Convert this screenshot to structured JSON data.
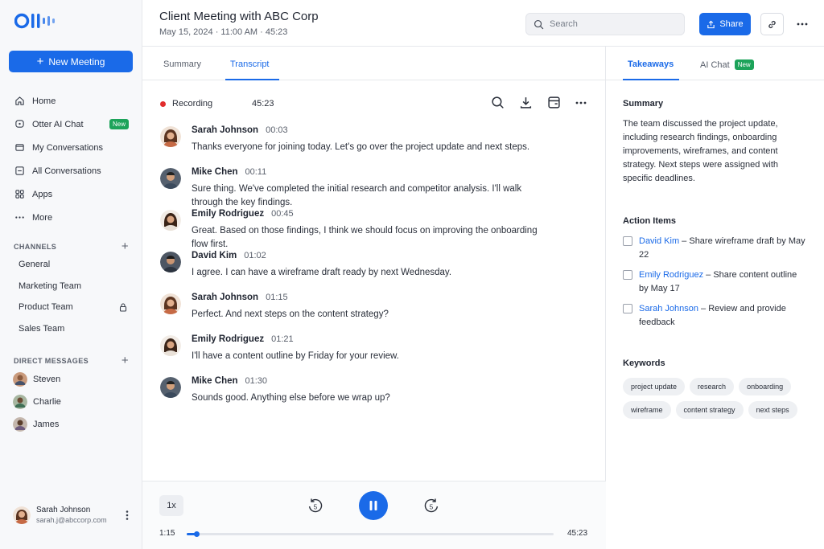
{
  "app": {
    "new_meeting_label": "New Meeting",
    "nav": [
      {
        "label": "Home",
        "icon": "home-icon"
      },
      {
        "label": "Otter AI Chat",
        "icon": "chat-icon",
        "badge": "New"
      },
      {
        "label": "My Conversations",
        "icon": "folder-icon"
      },
      {
        "label": "All Conversations",
        "icon": "list-icon"
      },
      {
        "label": "Apps",
        "icon": "grid-icon"
      },
      {
        "label": "More",
        "icon": "dots-icon"
      }
    ],
    "channels_heading": "CHANNELS",
    "channels": [
      "General",
      "Marketing Team",
      "Product Team",
      "Sales Team"
    ],
    "dm_heading": "DIRECT MESSAGES",
    "direct_messages": [
      "Steven",
      "Charlie",
      "James"
    ],
    "profile": {
      "name": "Sarah Johnson",
      "email": "sarah.j@abccorp.com"
    }
  },
  "header": {
    "title": "Client Meeting with ABC Corp",
    "subtitle": "May 15, 2024 · 11:00 AM · 45:23",
    "search_placeholder": "Search",
    "share_label": "Share"
  },
  "center": {
    "tabs": [
      "Summary",
      "Transcript"
    ],
    "active_tab": "Transcript",
    "recording_label": "Recording",
    "recording_time": "45:23",
    "transcript": [
      {
        "speaker": "Sarah Johnson",
        "time": "00:03",
        "text": "Thanks everyone for joining today. Let's go over the project update and next steps."
      },
      {
        "speaker": "Mike Chen",
        "time": "00:11",
        "text": "Sure thing. We've completed the initial research and competitor analysis. I'll walk through the key findings."
      },
      {
        "speaker": "Emily Rodriguez",
        "time": "00:45",
        "text": "Great. Based on those findings, I think we should focus on improving the onboarding flow first."
      },
      {
        "speaker": "David Kim",
        "time": "01:02",
        "text": "I agree. I can have a wireframe draft ready by next Wednesday."
      },
      {
        "speaker": "Sarah Johnson",
        "time": "01:15",
        "text": "Perfect. And next steps on the content strategy?"
      },
      {
        "speaker": "Emily Rodriguez",
        "time": "01:21",
        "text": "I'll have a content outline by Friday for your review."
      },
      {
        "speaker": "Mike Chen",
        "time": "01:30",
        "text": "Sounds good. Anything else before we wrap up?"
      }
    ],
    "player": {
      "speed": "1x",
      "current": "1:15",
      "total": "45:23",
      "progress": 0.027
    }
  },
  "right": {
    "tabs": [
      "Takeaways",
      "AI Chat"
    ],
    "ai_chat_badge": "New",
    "summary_heading": "Summary",
    "summary_text": "The team discussed the project update, including research findings, onboarding improvements, wireframes, and content strategy. Next steps were assigned with specific deadlines.",
    "action_items_heading": "Action Items",
    "action_items": [
      {
        "person": "David Kim",
        "task": " – Share wireframe draft by May 22"
      },
      {
        "person": "Emily Rodriguez",
        "task": " – Share content outline by May 17"
      },
      {
        "person": "Sarah Johnson",
        "task": " – Review and provide feedback"
      }
    ],
    "keywords_heading": "Keywords",
    "keywords": [
      "project update",
      "research",
      "onboarding",
      "wireframe",
      "content strategy",
      "next steps"
    ]
  },
  "colors": {
    "accent": "#1a6ae8",
    "new_badge": "#1da35a",
    "recording": "#e12d2d"
  }
}
